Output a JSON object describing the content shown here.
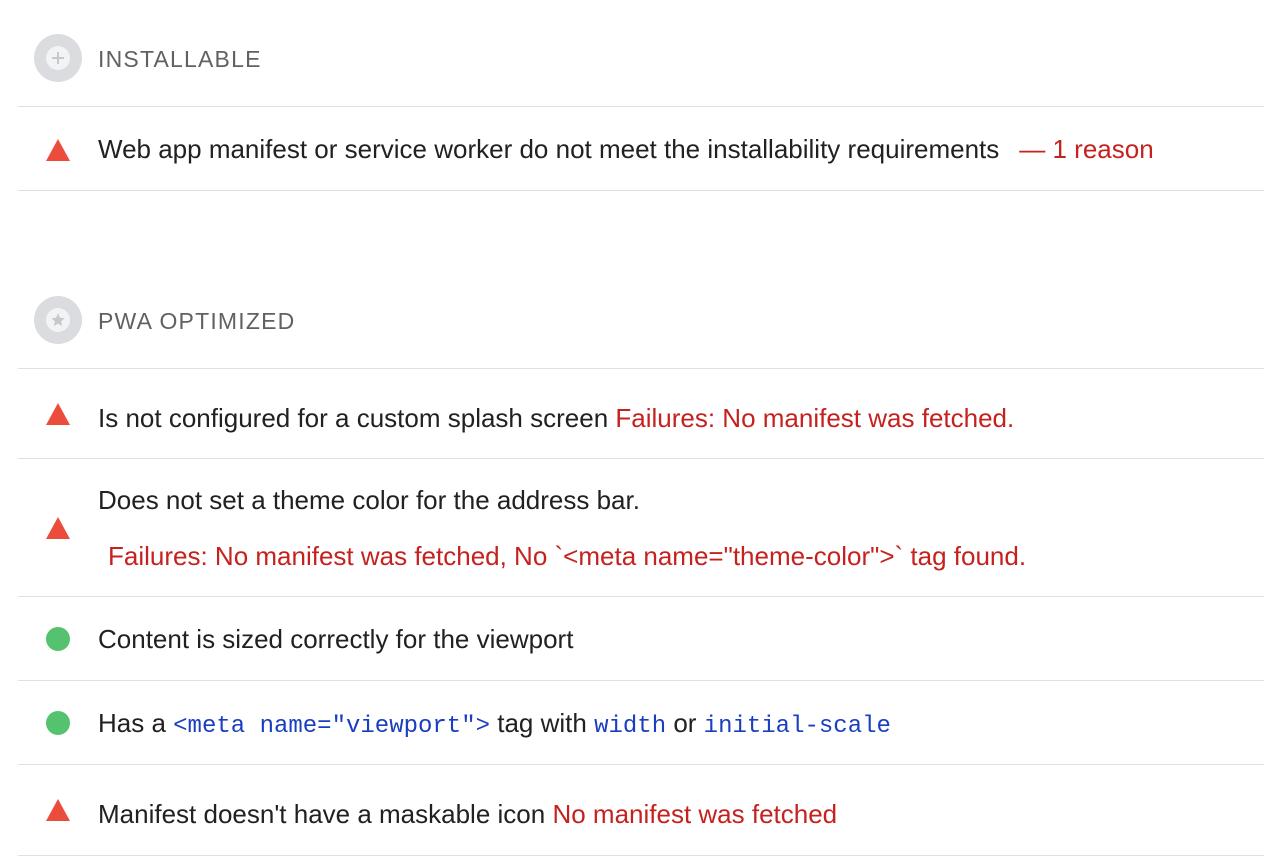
{
  "colors": {
    "fail": "#c5221f",
    "warning_icon": "#eb4c3c",
    "pass_icon": "#54c26f",
    "code": "#1a3ec0",
    "divider": "#e0e0e0"
  },
  "groups": [
    {
      "title": "INSTALLABLE",
      "icon": "plus-icon",
      "audits": [
        {
          "status": "fail",
          "icon": "warning-triangle-icon",
          "title": "Web app manifest or service worker do not meet the installability requirements",
          "detail": "— 1 reason"
        }
      ]
    },
    {
      "title": "PWA OPTIMIZED",
      "icon": "star-icon",
      "audits": [
        {
          "status": "fail",
          "icon": "warning-triangle-icon",
          "title": "Is not configured for a custom splash screen",
          "detail": "Failures: No manifest was fetched."
        },
        {
          "status": "fail",
          "icon": "warning-triangle-icon",
          "title": "Does not set a theme color for the address bar.",
          "detail": "Failures: No manifest was fetched, No `<meta name=\"theme-color\">` tag found."
        },
        {
          "status": "pass",
          "icon": "pass-circle-icon",
          "title": "Content is sized correctly for the viewport"
        },
        {
          "status": "pass",
          "icon": "pass-circle-icon",
          "title_parts": {
            "t1": "Has a ",
            "c1": "<meta name=\"viewport\">",
            "t2": " tag with ",
            "c2": "width",
            "t3": " or ",
            "c3": "initial-scale"
          }
        },
        {
          "status": "fail",
          "icon": "warning-triangle-icon",
          "title": "Manifest doesn't have a maskable icon",
          "detail": "No manifest was fetched"
        }
      ]
    }
  ]
}
